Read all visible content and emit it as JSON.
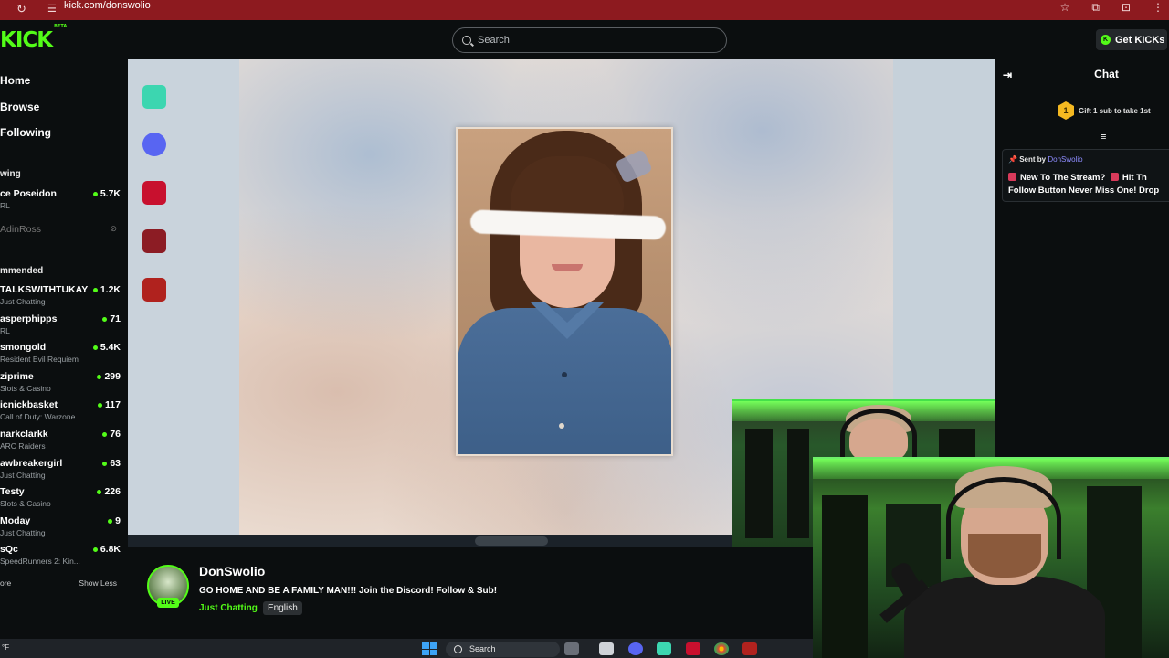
{
  "browser": {
    "url": "kick.com/donswolio",
    "reload_icon": "reload-icon",
    "icons": [
      "star-icon",
      "extensions-icon",
      "split-icon",
      "menu-icon"
    ]
  },
  "header": {
    "logo": "KICK",
    "logo_badge": "BETA",
    "search_placeholder": "Search",
    "get_kicks": "Get KICKs"
  },
  "sidebar": {
    "nav": [
      "Home",
      "Browse",
      "Following"
    ],
    "following_title": "wing",
    "following": [
      {
        "name": "ce Poseidon",
        "category": "RL",
        "viewers": "5.7K",
        "live": true
      },
      {
        "name": "AdinRoss",
        "category": "",
        "viewers": "",
        "live": false
      }
    ],
    "recommended_title": "mmended",
    "recommended": [
      {
        "name": "TALKSWITHTUKAY",
        "category": "Just Chatting",
        "viewers": "1.2K"
      },
      {
        "name": "asperphipps",
        "category": "RL",
        "viewers": "71"
      },
      {
        "name": "smongold",
        "category": "Resident Evil Requiem",
        "viewers": "5.4K"
      },
      {
        "name": "ziprime",
        "category": "Slots & Casino",
        "viewers": "299"
      },
      {
        "name": "icnickbasket",
        "category": "Call of Duty: Warzone",
        "viewers": "117"
      },
      {
        "name": "narkclarkk",
        "category": "ARC Raiders",
        "viewers": "76"
      },
      {
        "name": "awbreakergirl",
        "category": "Just Chatting",
        "viewers": "63"
      },
      {
        "name": "Testy",
        "category": "Slots & Casino",
        "viewers": "226"
      },
      {
        "name": "Moday",
        "category": "Just Chatting",
        "viewers": "9"
      },
      {
        "name": "sQc",
        "category": "SpeedRunners 2: Kin...",
        "viewers": "6.8K"
      }
    ],
    "show_more": "ore",
    "show_less": "Show Less"
  },
  "stream": {
    "streamer": "DonSwolio",
    "live": "LIVE",
    "title": "GO HOME AND BE A FAMILY MAN!!! Join the Discord! Follow & Sub!",
    "category": "Just Chatting",
    "language": "English"
  },
  "chat": {
    "title": "Chat",
    "gift_count": "1",
    "gift_text": "Gift 1 sub to take 1st",
    "pinned_sent_by": "Sent by",
    "pinned_user": "DonSwolio",
    "pinned_line1": "New To The Stream?",
    "pinned_line1b": "Hit Th",
    "pinned_line2": "Follow Button Never Miss One! Drop"
  },
  "taskbar": {
    "temp": "°F",
    "search": "Search"
  },
  "colors": {
    "kick_green": "#53fc18",
    "browser_red": "#8d1a1f",
    "bg": "#0b0e0f"
  }
}
